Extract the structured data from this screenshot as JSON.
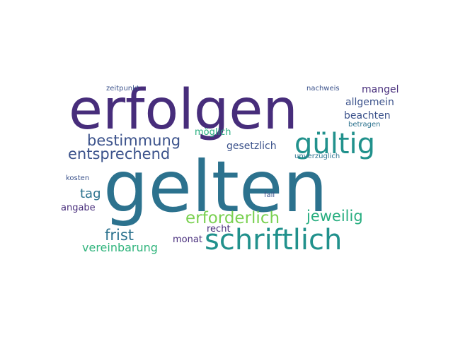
{
  "word_cloud": {
    "words": [
      {
        "text": "gelten",
        "color": "#2c728e"
      },
      {
        "text": "erfolgen",
        "color": "#472d7b"
      },
      {
        "text": "schriftlich",
        "color": "#21918c"
      },
      {
        "text": "gültig",
        "color": "#21918c"
      },
      {
        "text": "erforderlich",
        "color": "#7ad151"
      },
      {
        "text": "bestimmung",
        "color": "#3b528b"
      },
      {
        "text": "entsprechend",
        "color": "#3b528b"
      },
      {
        "text": "jeweilig",
        "color": "#28ae80"
      },
      {
        "text": "frist",
        "color": "#2c728e"
      },
      {
        "text": "tag",
        "color": "#2c728e"
      },
      {
        "text": "vereinbarung",
        "color": "#2fb47c"
      },
      {
        "text": "gesetzlich",
        "color": "#3b528b"
      },
      {
        "text": "mangel",
        "color": "#472d7b"
      },
      {
        "text": "beachten",
        "color": "#3b528b"
      },
      {
        "text": "allgemein",
        "color": "#3b528b"
      },
      {
        "text": "möglich",
        "color": "#28ae80"
      },
      {
        "text": "recht",
        "color": "#472d7b"
      },
      {
        "text": "monat",
        "color": "#472d7b"
      },
      {
        "text": "angabe",
        "color": "#472d7b"
      },
      {
        "text": "zeitpunkt",
        "color": "#3b528b"
      },
      {
        "text": "nachweis",
        "color": "#3b528b"
      },
      {
        "text": "betragen",
        "color": "#2c728e"
      },
      {
        "text": "unverzüglich",
        "color": "#2c728e"
      },
      {
        "text": "kosten",
        "color": "#3b528b"
      },
      {
        "text": "fall",
        "color": "#3b528b"
      }
    ]
  }
}
